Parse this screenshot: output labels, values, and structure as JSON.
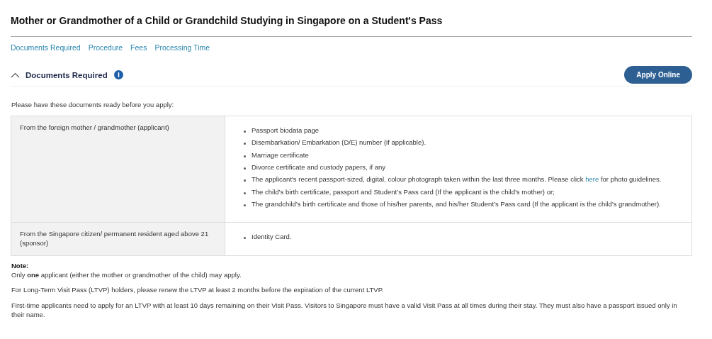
{
  "page_title": "Mother or Grandmother of a Child or Grandchild Studying in Singapore on a Student's Pass",
  "anchor_links": [
    "Documents Required",
    "Procedure",
    "Fees",
    "Processing Time"
  ],
  "section": {
    "title": "Documents Required",
    "expanded": true,
    "apply_button": "Apply Online",
    "intro": "Please have these documents ready before you apply:",
    "table": {
      "rows": [
        {
          "party": "From the foreign mother / grandmother (applicant)",
          "documents": [
            {
              "text": "Passport biodata page"
            },
            {
              "text": "Disembarkation/ Embarkation (D/E) number (if applicable)."
            },
            {
              "text": "Marriage certificate"
            },
            {
              "text": "Divorce certificate and custody papers, if any"
            },
            {
              "text": "The applicant's recent passport-sized, digital, colour photograph taken within the last three months. Please click",
              "link": "here",
              "text_after": "for photo guidelines."
            },
            {
              "text": "The child’s birth certificate, passport and Student’s Pass card (If the applicant is the child’s mother) or;"
            },
            {
              "text": "The grandchild’s birth certificate and those of his/her parents, and his/her Student’s Pass card (If the applicant is the child’s grandmother)."
            }
          ]
        },
        {
          "party": "From the Singapore citizen/ permanent resident aged above 21 (sponsor)",
          "documents": [
            {
              "text": "Identity Card."
            }
          ]
        }
      ]
    },
    "note": {
      "heading": "Note:",
      "paragraphs": [
        "Only **one** applicant (either the mother or grandmother of the child) may apply.",
        "For Long-Term Visit Pass (LTVP) holders, please renew the LTVP at least 2 months before the expiration of the current LTVP.",
        "First-time applicants need to apply for an LTVP with at least 10 days remaining on their Visit Pass. Visitors to Singapore must have a valid Visit Pass at all times during their stay. They must also have a passport issued only in their name."
      ]
    }
  }
}
